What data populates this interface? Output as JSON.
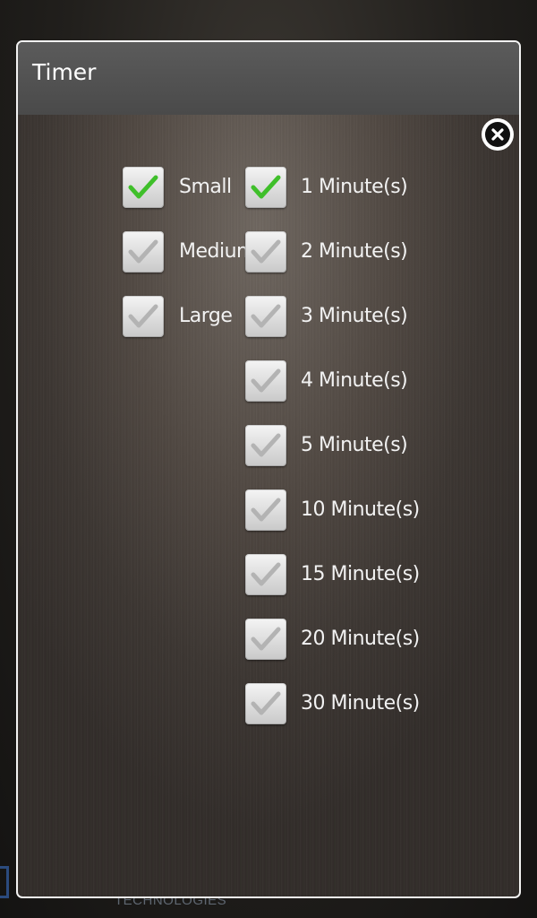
{
  "background": {
    "footer_text": "TECHNOLOGIES"
  },
  "dialog": {
    "title": "Timer",
    "close_icon": "close-circle-icon"
  },
  "sizes": [
    {
      "label": "Small",
      "checked": true
    },
    {
      "label": "Medium",
      "checked": false
    },
    {
      "label": "Large",
      "checked": false
    }
  ],
  "durations": [
    {
      "label": "1 Minute(s)",
      "checked": true
    },
    {
      "label": "2 Minute(s)",
      "checked": false
    },
    {
      "label": "3 Minute(s)",
      "checked": false
    },
    {
      "label": "4 Minute(s)",
      "checked": false
    },
    {
      "label": "5 Minute(s)",
      "checked": false
    },
    {
      "label": "10 Minute(s)",
      "checked": false
    },
    {
      "label": "15 Minute(s)",
      "checked": false
    },
    {
      "label": "20 Minute(s)",
      "checked": false
    },
    {
      "label": "30 Minute(s)",
      "checked": false
    }
  ],
  "colors": {
    "check_active": "#3fbf2a",
    "check_inactive": "#b3b3b3"
  }
}
